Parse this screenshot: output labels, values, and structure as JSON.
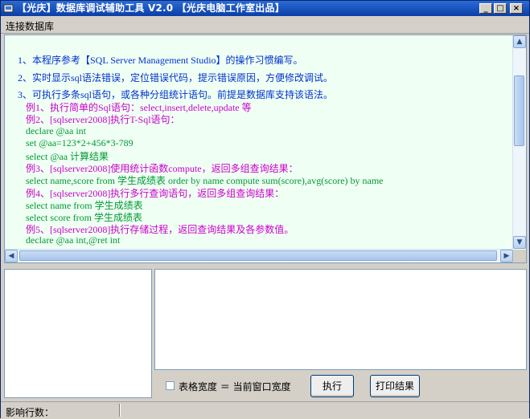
{
  "window": {
    "title": "【光庆】数据库调试辅助工具 V2.0 【光庆电脑工作室出品】",
    "buttons": {
      "minimize": "_",
      "maximize": "□",
      "close": "×"
    }
  },
  "menu": {
    "connect": "连接数据库"
  },
  "editor": {
    "lines": [
      {
        "text": "1、本程序参考【SQL Server Management Studio】的操作习惯编写。",
        "color": "#0033cc"
      },
      {
        "text": "2、实时显示sql语法错误，定位错误代码，提示错误原因，方便修改调试。",
        "color": "#0033cc"
      },
      {
        "text": "3、可执行多条sql语句，或各种分组统计语句。前提是数据库支持该语法。",
        "color": "#0033cc"
      },
      {
        "text": "例1、执行简单的Sql语句：select,insert,delete,update 等",
        "color": "#cc00cc"
      },
      {
        "text": "例2、[sqlserver2008]执行T-Sql语句：",
        "color": "#cc00cc"
      },
      {
        "text": "declare @aa int",
        "color": "#009933"
      },
      {
        "text": "set @aa=123*2+456*3-789",
        "color": "#009933"
      },
      {
        "text": "select @aa 计算结果",
        "color": "#009933"
      },
      {
        "text": "例3、[sqlserver2008]使用统计函数compute，返回多组查询结果：",
        "color": "#cc00cc"
      },
      {
        "text": "select name,score from 学生成绩表  order by name compute sum(score),avg(score) by name",
        "color": "#009933"
      },
      {
        "text": "例4、[sqlserver2008]执行多行查询语句，返回多组查询结果：",
        "color": "#cc00cc"
      },
      {
        "text": "select name from 学生成绩表",
        "color": "#009933"
      },
      {
        "text": "select score from 学生成绩表",
        "color": "#009933"
      },
      {
        "text": "例5、[sqlserver2008]执行存储过程，返回查询结果及各参数值。",
        "color": "#cc00cc"
      },
      {
        "text": "declare @aa int,@ret int",
        "color": "#009933"
      }
    ]
  },
  "controls": {
    "checkbox_label": "表格宽度 ＝ 当前窗口宽度",
    "execute_button": "执行",
    "print_button": "打印结果"
  },
  "status": {
    "affected_rows_label": "影响行数："
  }
}
